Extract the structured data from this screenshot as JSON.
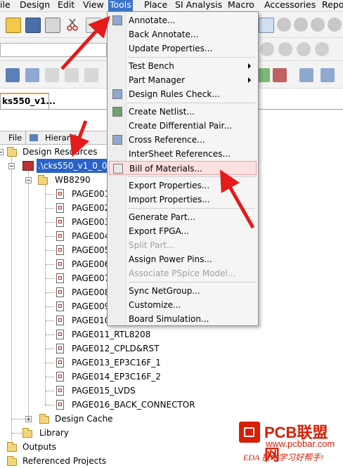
{
  "menubar": {
    "items": [
      "ile",
      "Design",
      "Edit",
      "View",
      "Tools",
      "Place",
      "SI Analysis",
      "Macro",
      "Accessories",
      "Repo"
    ],
    "active": "Tools"
  },
  "document_tab": {
    "label": "ks550_v1..."
  },
  "panel_tabs": {
    "file": "File",
    "hierarchy": "Hierarch"
  },
  "tree": {
    "design_resources": "Design Resources",
    "design_file": ".\\cks550_v1_0_0_",
    "schematic": "WB8290",
    "pages": [
      "PAGE001",
      "PAGE002",
      "PAGE003",
      "PAGE004",
      "PAGE005",
      "PAGE006",
      "PAGE007",
      "PAGE008",
      "PAGE009",
      "PAGE010",
      "PAGE011_RTL8208",
      "PAGE012_CPLD&RST",
      "PAGE013_EP3C16F_1",
      "PAGE014_EP3C16F_2",
      "PAGE015_LVDS",
      "PAGE016_BACK_CONNECTOR"
    ],
    "design_cache": "Design Cache",
    "library": "Library",
    "outputs": "Outputs",
    "referenced_projects": "Referenced Projects"
  },
  "tools_menu": {
    "items": [
      {
        "label": "Annotate...",
        "enabled": true
      },
      {
        "label": "Back Annotate...",
        "enabled": true
      },
      {
        "label": "Update Properties...",
        "enabled": true
      },
      {
        "label": "Test Bench",
        "enabled": true,
        "submenu": true
      },
      {
        "label": "Part Manager",
        "enabled": true,
        "submenu": true
      },
      {
        "label": "Design Rules Check...",
        "enabled": true
      },
      {
        "label": "Create Netlist...",
        "enabled": true
      },
      {
        "label": "Create Differential Pair...",
        "enabled": true
      },
      {
        "label": "Cross Reference...",
        "enabled": true
      },
      {
        "label": "InterSheet References...",
        "enabled": true
      },
      {
        "label": "Bill of Materials...",
        "enabled": true,
        "highlighted": true
      },
      {
        "label": "Export Properties...",
        "enabled": true
      },
      {
        "label": "Import Properties...",
        "enabled": true
      },
      {
        "label": "Generate Part...",
        "enabled": true
      },
      {
        "label": "Export FPGA...",
        "enabled": true
      },
      {
        "label": "Split Part...",
        "enabled": false
      },
      {
        "label": "Assign Power Pins...",
        "enabled": true
      },
      {
        "label": "Associate PSpice Model...",
        "enabled": false
      },
      {
        "label": "Sync NetGroup...",
        "enabled": true
      },
      {
        "label": "Customize...",
        "enabled": true
      },
      {
        "label": "Board Simulation...",
        "enabled": true
      }
    ]
  },
  "watermark": {
    "brand": "PCB联盟网",
    "url": "www.pcbbar.com",
    "slogan": "EDA 技术学习好帮手!"
  },
  "colors": {
    "menu_active": "#3a73c9",
    "selection": "#2a62c9",
    "highlight_bg": "#fde0e0",
    "annotation_arrow": "#e51a1a",
    "watermark": "#d81e06"
  }
}
